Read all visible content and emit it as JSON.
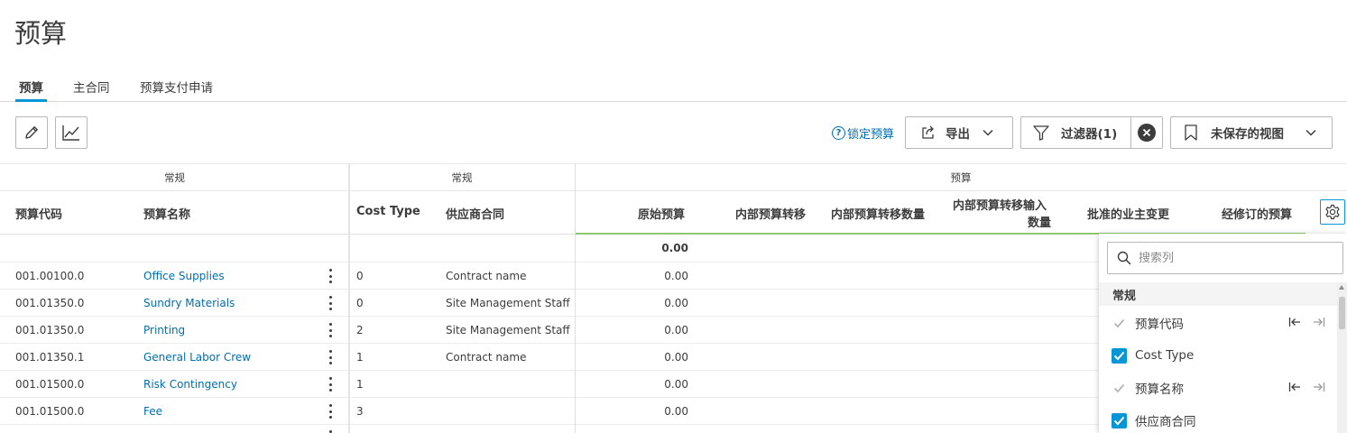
{
  "page": {
    "title": "预算"
  },
  "tabs": [
    {
      "label": "预算",
      "active": true
    },
    {
      "label": "主合同",
      "active": false
    },
    {
      "label": "预算支付申请",
      "active": false
    }
  ],
  "toolbar": {
    "edit_icon": "pencil-icon",
    "chart_icon": "line-chart-icon",
    "lock_budget_label": "锁定预算",
    "export_label": "导出",
    "filter_label": "过滤器(1)",
    "saved_view_label": "未保存的视图"
  },
  "grid": {
    "groups": [
      "常规",
      "常规",
      "预算"
    ],
    "columns": {
      "code": "预算代码",
      "name": "预算名称",
      "cost_type": "Cost Type",
      "contract": "供应商合同",
      "original": "原始预算",
      "transfer": "内部预算转移",
      "transfer_qty": "内部预算转移数量",
      "transfer_in_qty_line1": "内部预算转移输入",
      "transfer_in_qty_line2": "数量",
      "approved_change": "批准的业主变更",
      "revised": "经修订的预算"
    },
    "total_original": "0.00",
    "rows": [
      {
        "code": "001.00100.0",
        "name": "Office Supplies",
        "cost_type": "0",
        "contract": "Contract name",
        "original": "0.00"
      },
      {
        "code": "001.01350.0",
        "name": "Sundry Materials",
        "cost_type": "0",
        "contract": "Site Management Staff",
        "original": "0.00"
      },
      {
        "code": "001.01350.0",
        "name": "Printing",
        "cost_type": "2",
        "contract": "Site Management Staff",
        "original": "0.00"
      },
      {
        "code": "001.01350.1",
        "name": "General Labor Crew",
        "cost_type": "1",
        "contract": "Contract name",
        "original": "0.00"
      },
      {
        "code": "001.01500.0",
        "name": "Risk Contingency",
        "cost_type": "1",
        "contract": "",
        "original": "0.00"
      },
      {
        "code": "001.01500.0",
        "name": "Fee",
        "cost_type": "3",
        "contract": "",
        "original": "0.00"
      }
    ]
  },
  "column_panel": {
    "search_placeholder": "搜索列",
    "section_title": "常规",
    "options": [
      {
        "label": "预算代码",
        "state": "disabled"
      },
      {
        "label": "Cost Type",
        "state": "checked"
      },
      {
        "label": "预算名称",
        "state": "disabled"
      },
      {
        "label": "供应商合同",
        "state": "checked"
      }
    ]
  },
  "colors": {
    "accent": "#0696d7",
    "link": "#006eaf",
    "text": "#3c3c3c"
  }
}
